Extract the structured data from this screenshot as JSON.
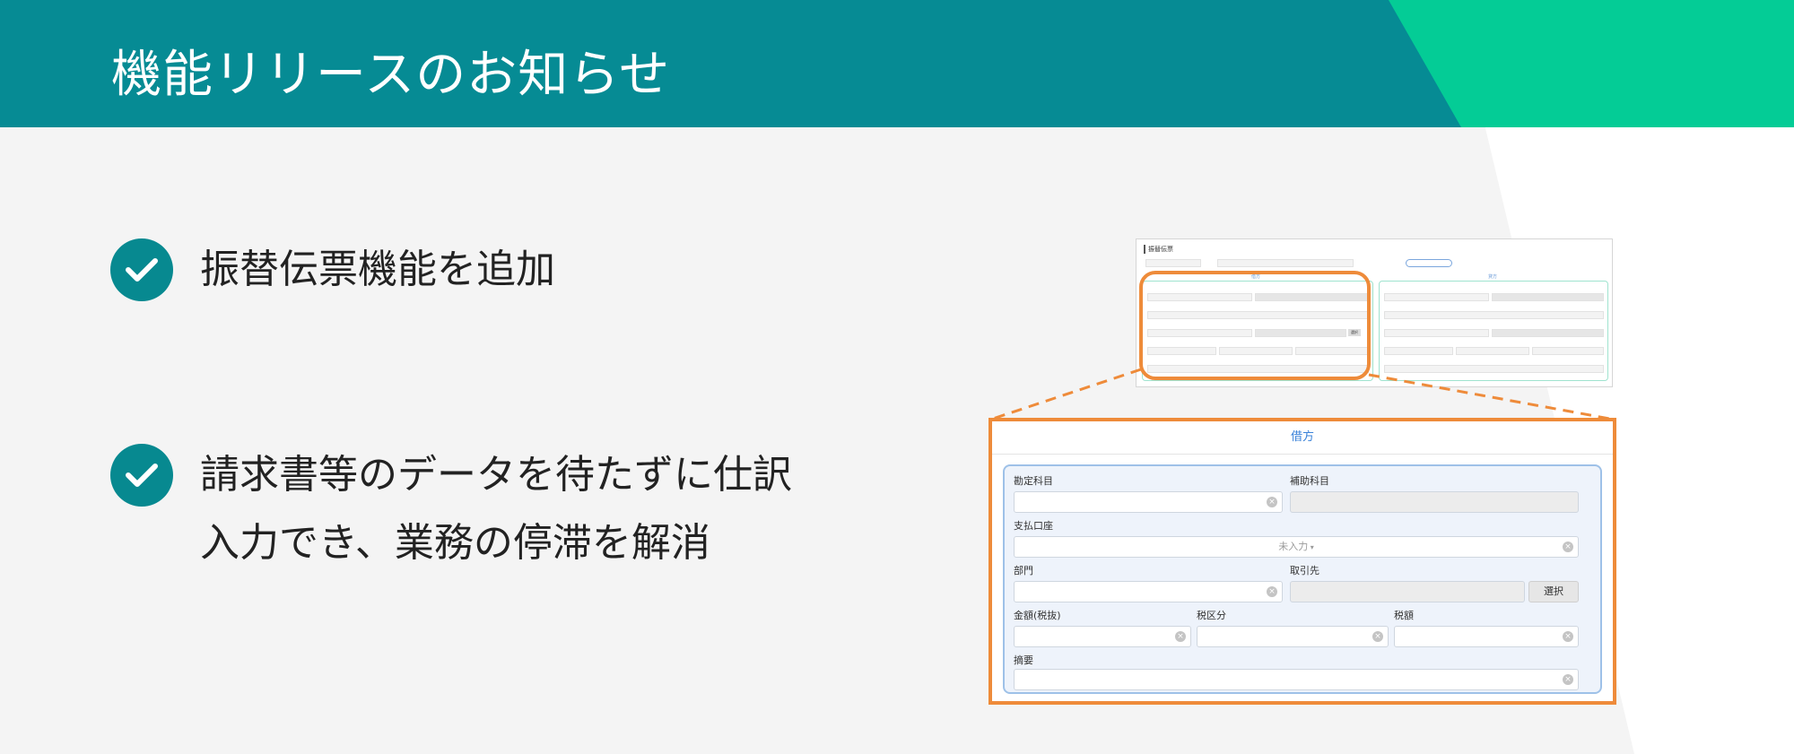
{
  "header": {
    "title": "機能リリースのお知らせ"
  },
  "bullets": [
    {
      "text": "振替伝票機能を追加"
    },
    {
      "line1": "請求書等のデータを待たずに仕訳",
      "line2": "入力でき、業務の停滞を解消"
    }
  ],
  "colors": {
    "header": "#068b94",
    "accent_green": "#04cc96",
    "check": "#078990",
    "highlight_orange": "#ee8b3a",
    "tab_blue": "#3a82d8"
  },
  "mini_screenshot": {
    "left_tab": "借方",
    "right_tab": "貸方",
    "button": "選択"
  },
  "form": {
    "tab": "借方",
    "account_label": "勘定科目",
    "sub_account_label": "補助科目",
    "payment_account_label": "支払口座",
    "payment_account_placeholder": "未入力",
    "department_label": "部門",
    "partner_label": "取引先",
    "select_button": "選択",
    "amount_label": "金額(税抜)",
    "tax_category_label": "税区分",
    "tax_amount_label": "税額",
    "memo_label": "摘要"
  }
}
